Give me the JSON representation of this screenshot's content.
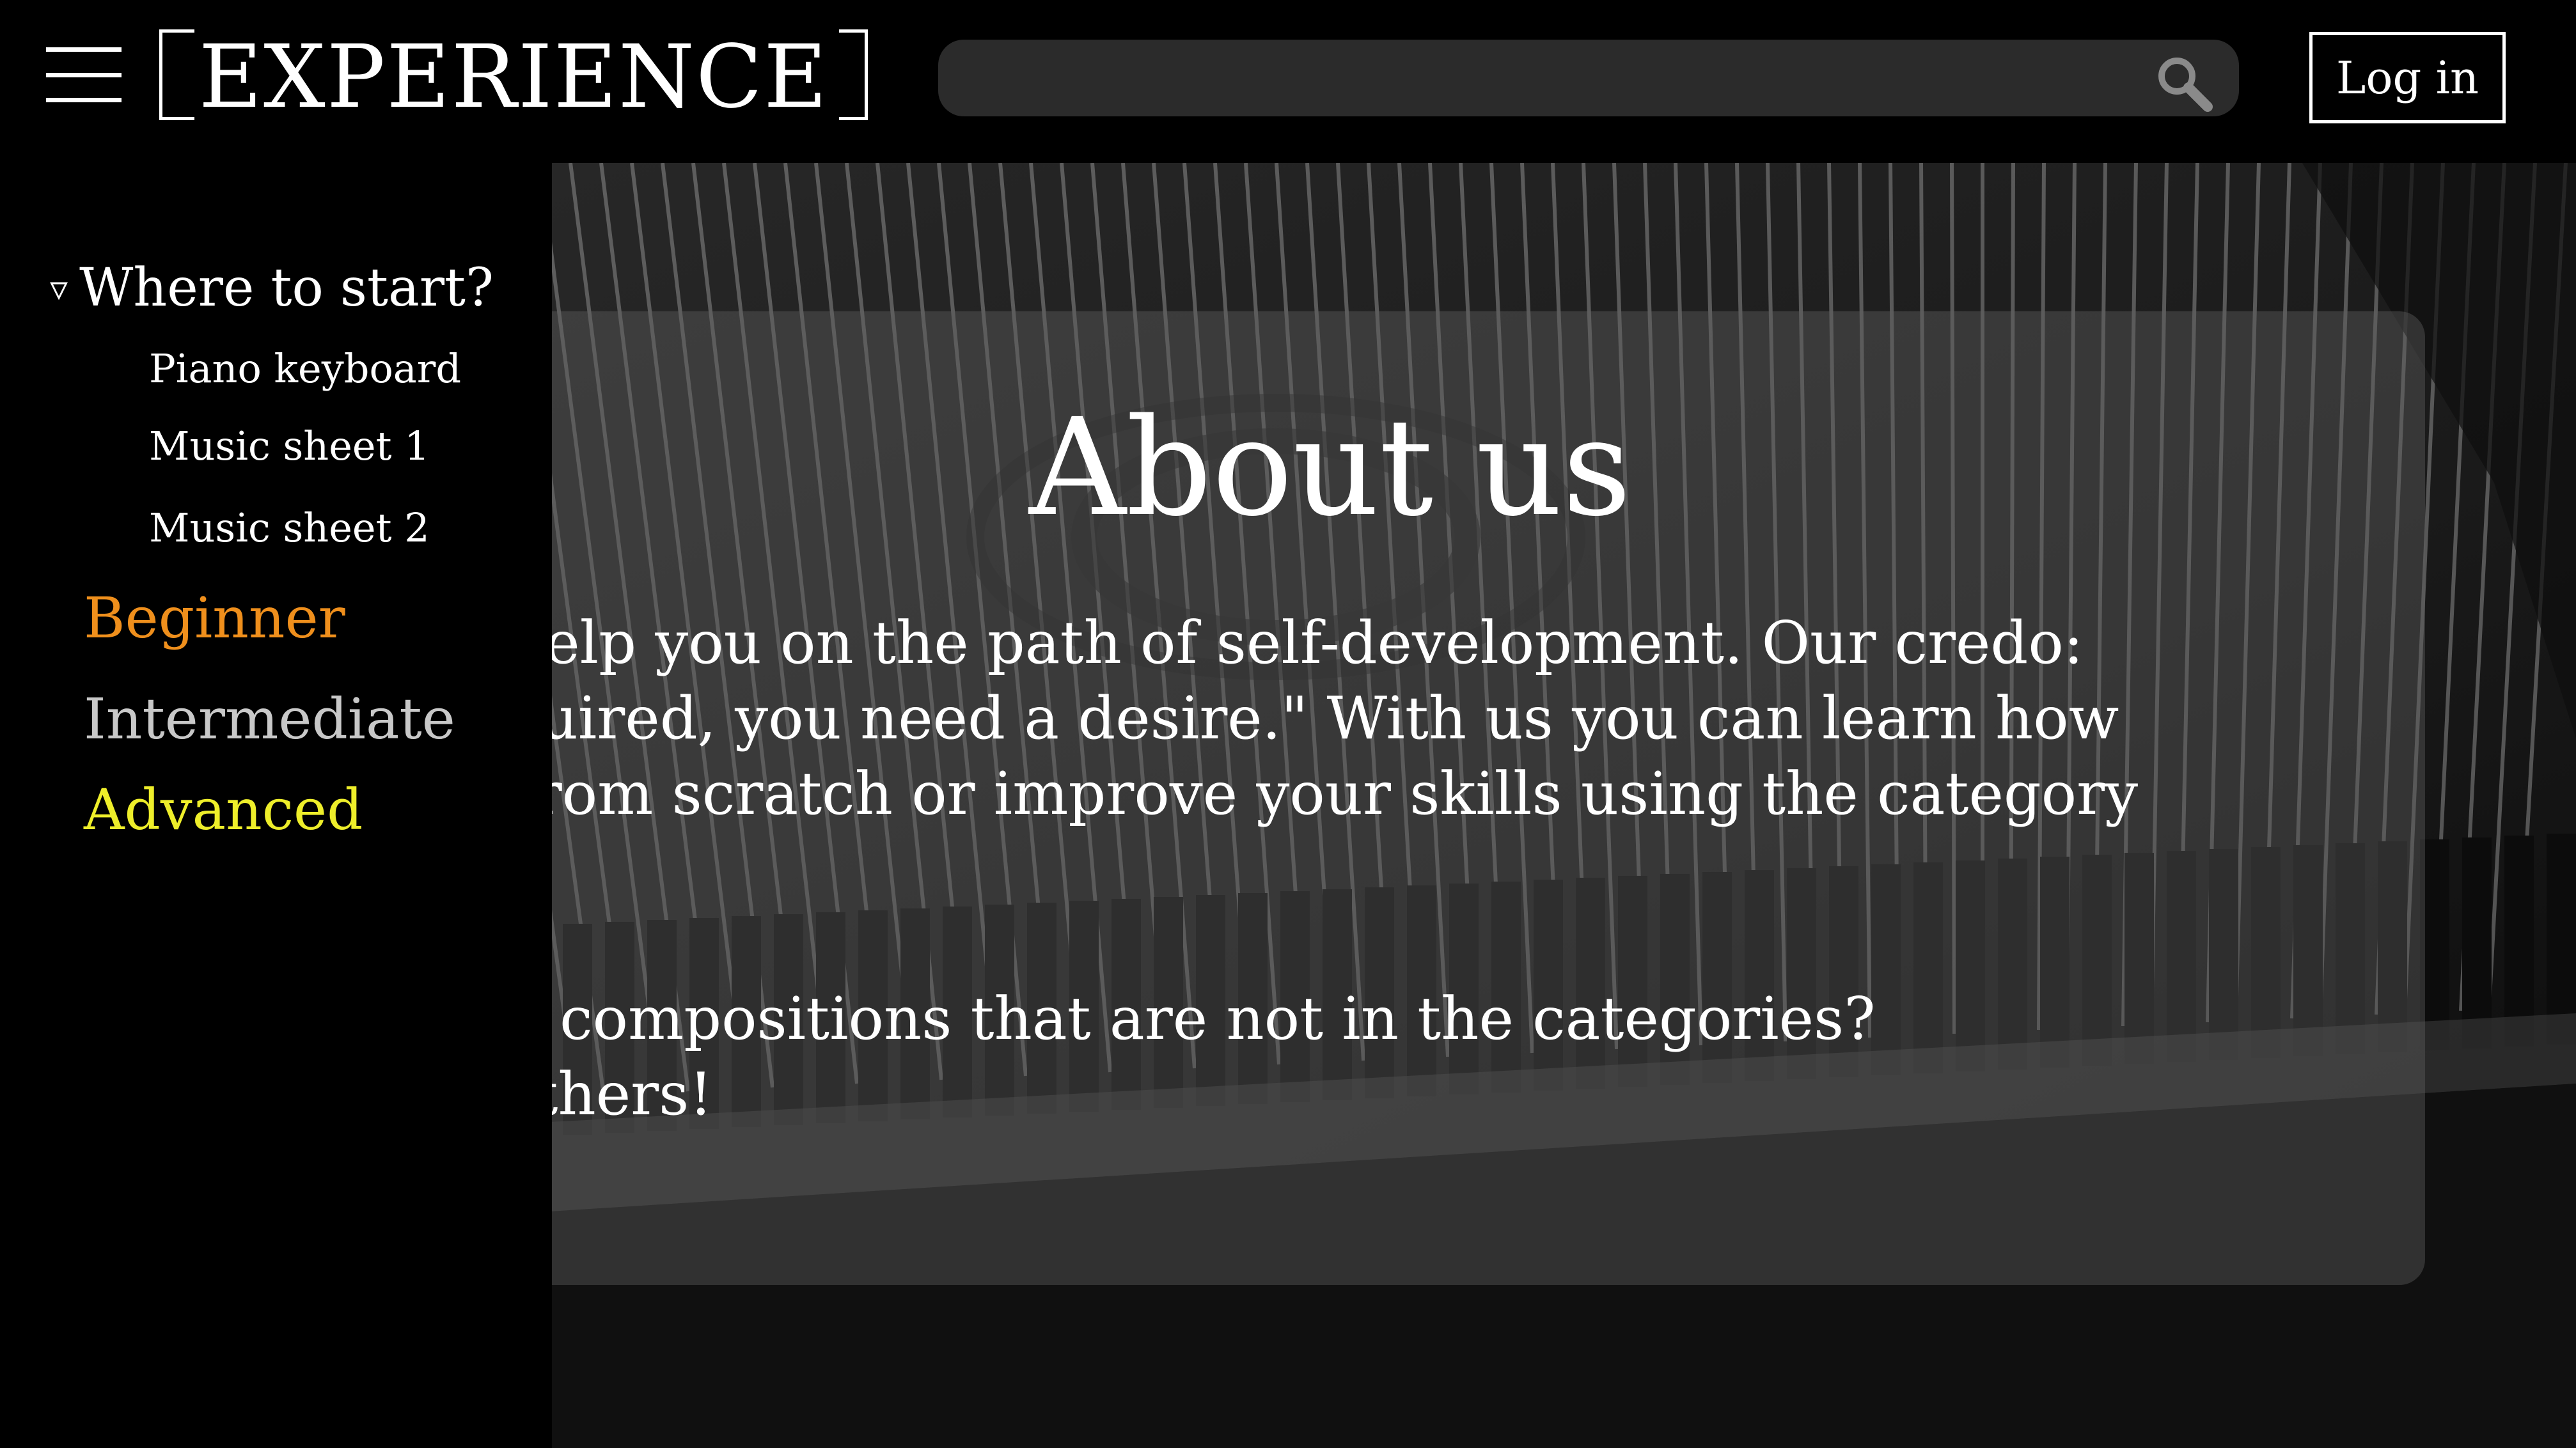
{
  "header": {
    "logo_text": "EXPERIENCE",
    "search": {
      "placeholder": "",
      "value": ""
    },
    "login_label": "Log in"
  },
  "sidebar": {
    "section_title": "Where to start?",
    "section_items": [
      "Piano keyboard",
      "Music sheet 1",
      "Music sheet 2"
    ],
    "levels": [
      {
        "label": "Beginner",
        "color": "#ef8f1c"
      },
      {
        "label": "Intermediate",
        "color": "#c8c8c8"
      },
      {
        "label": "Advanced",
        "color": "#eeee2a"
      }
    ]
  },
  "about": {
    "title": "About us",
    "paragraph1": [
      "here to help you on the path of self-development. Our credo:",
      "s not required, you need a desire.\" With us you can learn how",
      "e piano from scratch or improve your skills using the category"
    ],
    "paragraph2": [
      "have any compositions that are not in the categories?",
      "m with others!"
    ]
  },
  "icons": {
    "menu": "hamburger-menu-icon",
    "search": "search-icon",
    "expand": "triangle-down-icon"
  },
  "colors": {
    "background": "#000000",
    "search_bar": "#2b2b2b",
    "card_overlay": "rgba(95,95,95,0.42)",
    "beginner": "#ef8f1c",
    "intermediate": "#c8c8c8",
    "advanced": "#eeee2a"
  }
}
